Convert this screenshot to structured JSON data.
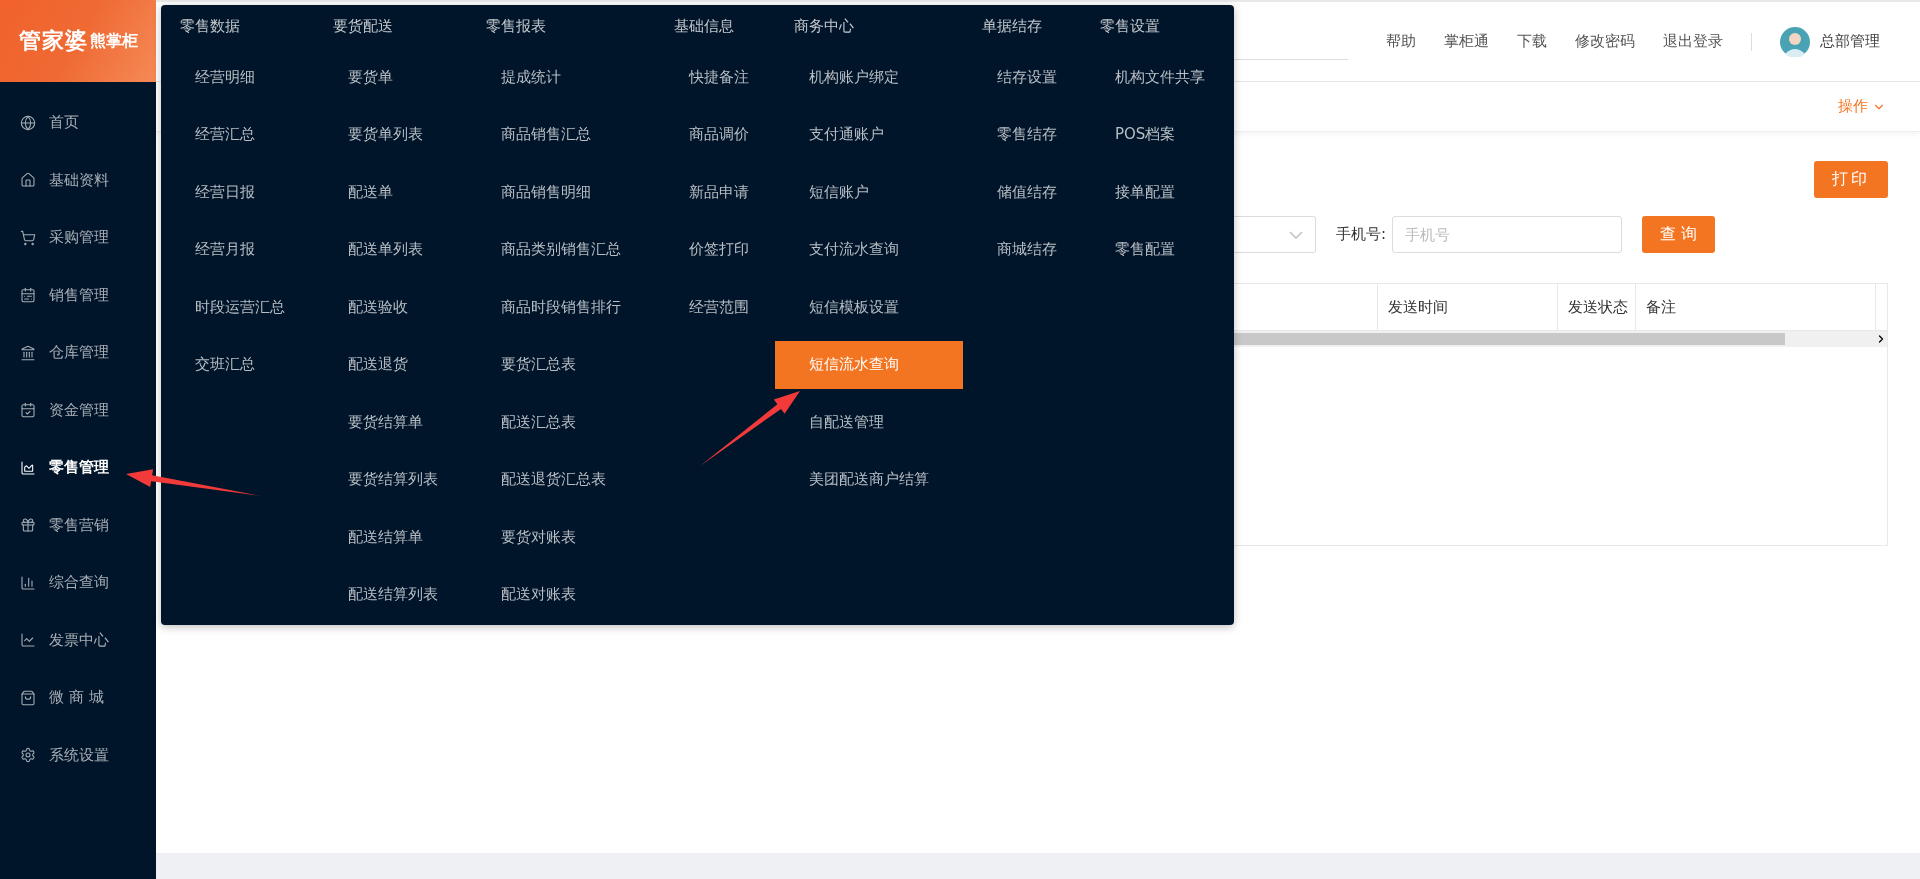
{
  "logo": {
    "brand": "管家婆",
    "product": "熊掌柜"
  },
  "sidebar": {
    "items": [
      {
        "label": "首页",
        "selected": false
      },
      {
        "label": "基础资料",
        "selected": false
      },
      {
        "label": "采购管理",
        "selected": false
      },
      {
        "label": "销售管理",
        "selected": false
      },
      {
        "label": "仓库管理",
        "selected": false
      },
      {
        "label": "资金管理",
        "selected": false
      },
      {
        "label": "零售管理",
        "selected": true
      },
      {
        "label": "零售营销",
        "selected": false
      },
      {
        "label": "综合查询",
        "selected": false
      },
      {
        "label": "发票中心",
        "selected": false
      },
      {
        "label": "微 商 城",
        "selected": false
      },
      {
        "label": "系统设置",
        "selected": false
      }
    ]
  },
  "top_nav": {
    "links": [
      "帮助",
      "掌柜通",
      "下载",
      "修改密码",
      "退出登录"
    ],
    "user": "总部管理"
  },
  "tab_bar": {
    "action": "操作"
  },
  "print_button": "打印",
  "filters": {
    "phone_label": "手机号:",
    "phone_placeholder": "手机号",
    "query_button": "查 询"
  },
  "table": {
    "columns": [
      "发送时间",
      "发送状态",
      "备注"
    ]
  },
  "mega_menu": {
    "columns": [
      {
        "title": "零售数据",
        "items": [
          {
            "label": "经营明细",
            "selected": false
          },
          {
            "label": "经营汇总",
            "selected": false
          },
          {
            "label": "经营日报",
            "selected": false
          },
          {
            "label": "经营月报",
            "selected": false
          },
          {
            "label": "时段运营汇总",
            "selected": false
          },
          {
            "label": "交班汇总",
            "selected": false
          }
        ]
      },
      {
        "title": "要货配送",
        "items": [
          {
            "label": "要货单",
            "selected": false
          },
          {
            "label": "要货单列表",
            "selected": false
          },
          {
            "label": "配送单",
            "selected": false
          },
          {
            "label": "配送单列表",
            "selected": false
          },
          {
            "label": "配送验收",
            "selected": false
          },
          {
            "label": "配送退货",
            "selected": false
          },
          {
            "label": "要货结算单",
            "selected": false
          },
          {
            "label": "要货结算列表",
            "selected": false
          },
          {
            "label": "配送结算单",
            "selected": false
          },
          {
            "label": "配送结算列表",
            "selected": false
          }
        ]
      },
      {
        "title": "零售报表",
        "items": [
          {
            "label": "提成统计",
            "selected": false
          },
          {
            "label": "商品销售汇总",
            "selected": false
          },
          {
            "label": "商品销售明细",
            "selected": false
          },
          {
            "label": "商品类别销售汇总",
            "selected": false
          },
          {
            "label": "商品时段销售排行",
            "selected": false
          },
          {
            "label": "要货汇总表",
            "selected": false
          },
          {
            "label": "配送汇总表",
            "selected": false
          },
          {
            "label": "配送退货汇总表",
            "selected": false
          },
          {
            "label": "要货对账表",
            "selected": false
          },
          {
            "label": "配送对账表",
            "selected": false
          }
        ]
      },
      {
        "title": "基础信息",
        "items": [
          {
            "label": "快捷备注",
            "selected": false
          },
          {
            "label": "商品调价",
            "selected": false
          },
          {
            "label": "新品申请",
            "selected": false
          },
          {
            "label": "价签打印",
            "selected": false
          },
          {
            "label": "经营范围",
            "selected": false
          }
        ]
      },
      {
        "title": "商务中心",
        "items": [
          {
            "label": "机构账户绑定",
            "selected": false
          },
          {
            "label": "支付通账户",
            "selected": false
          },
          {
            "label": "短信账户",
            "selected": false
          },
          {
            "label": "支付流水查询",
            "selected": false
          },
          {
            "label": "短信模板设置",
            "selected": false
          },
          {
            "label": "短信流水查询",
            "selected": true
          },
          {
            "label": "自配送管理",
            "selected": false
          },
          {
            "label": "美团配送商户结算",
            "selected": false
          }
        ]
      },
      {
        "title": "单据结存",
        "items": [
          {
            "label": "结存设置",
            "selected": false
          },
          {
            "label": "零售结存",
            "selected": false
          },
          {
            "label": "储值结存",
            "selected": false
          },
          {
            "label": "商城结存",
            "selected": false
          }
        ]
      },
      {
        "title": "零售设置",
        "items": [
          {
            "label": "机构文件共享",
            "selected": false
          },
          {
            "label": "POS档案",
            "selected": false
          },
          {
            "label": "接单配置",
            "selected": false
          },
          {
            "label": "零售配置",
            "selected": false
          }
        ]
      }
    ]
  }
}
